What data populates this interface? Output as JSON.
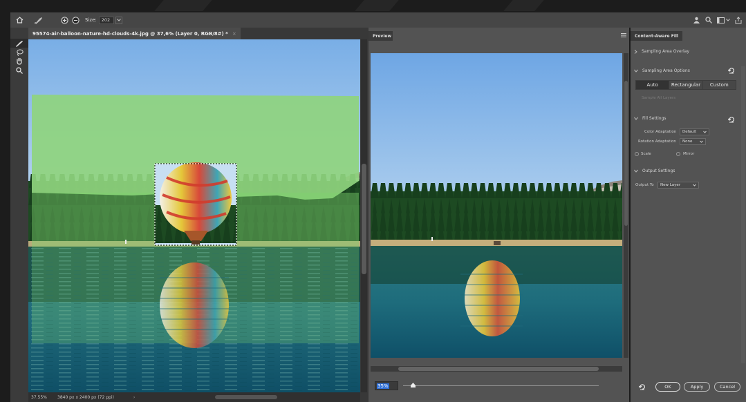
{
  "topbar": {
    "size_label": "Size:",
    "size_value": "202"
  },
  "document": {
    "tab_title": "95574-air-balloon-nature-hd-clouds-4k.jpg @ 37,6% (Layer 0, RGB/8#) *",
    "tab_close": "×",
    "zoom_level": "37.55%",
    "dimensions": "3840 px x 2400 px (72 ppi)"
  },
  "preview": {
    "tab_label": "Preview",
    "zoom_value": "35%",
    "zoom_slider_fraction": 0.05
  },
  "panel": {
    "tab_label": "Content-Aware Fill",
    "sampling_area_overlay": "Sampling Area Overlay",
    "sampling_area_options": "Sampling Area Options",
    "sampling_modes": [
      "Auto",
      "Rectangular",
      "Custom"
    ],
    "sampling_mode_selected": "Auto",
    "sample_all_layers": "Sample All Layers",
    "fill_settings": "Fill Settings",
    "color_adaptation_label": "Color Adaptation",
    "color_adaptation_value": "Default",
    "rotation_adaptation_label": "Rotation Adaptation",
    "rotation_adaptation_value": "None",
    "scale_label": "Scale",
    "mirror_label": "Mirror",
    "output_settings": "Output Settings",
    "output_to_label": "Output To",
    "output_to_value": "New Layer",
    "ok_label": "OK",
    "apply_label": "Apply",
    "cancel_label": "Cancel"
  },
  "colors": {
    "sky_top": "#7fb0e6",
    "sky_bottom": "#c4dcf2",
    "forest": "#1d4a22",
    "sampling_overlay": "#7ed36f",
    "water": "#21717f",
    "panel_bg": "#535353"
  },
  "icons": {
    "home": "home-icon",
    "brush": "content-aware-brush-icon",
    "add": "add-circle-icon",
    "subtract": "subtract-circle-icon",
    "lasso": "lasso-icon",
    "hand": "hand-icon",
    "zoom": "zoom-icon",
    "reset": "reset-icon"
  }
}
